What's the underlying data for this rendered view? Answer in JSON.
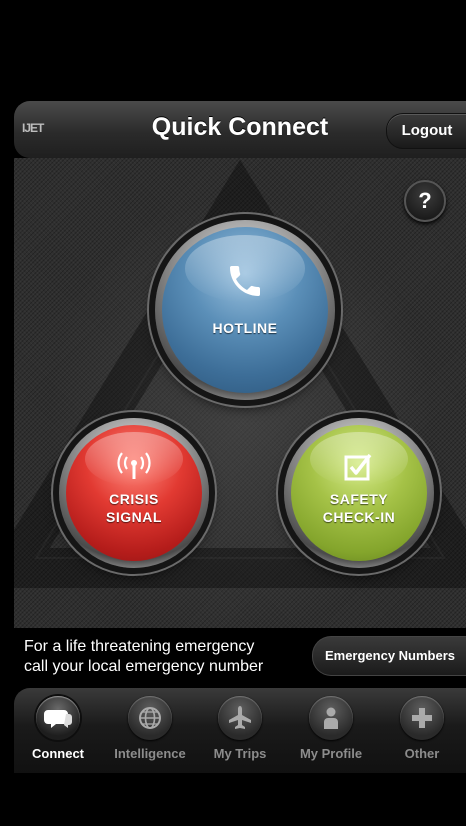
{
  "header": {
    "logo_text": "IJET",
    "title": "Quick Connect",
    "logout_label": "Logout"
  },
  "help": {
    "label": "?"
  },
  "buttons": {
    "hotline": {
      "label": "HOTLINE",
      "icon": "phone-icon",
      "color": "#4a7fab"
    },
    "crisis": {
      "line1": "CRISIS",
      "line2": "SIGNAL",
      "icon": "broadcast-icon",
      "color": "#d42e28"
    },
    "safety": {
      "line1": "SAFETY",
      "line2": "CHECK-IN",
      "icon": "checkbox-icon",
      "color": "#9bb83e"
    }
  },
  "info": {
    "line1": "For a life threatening emergency",
    "line2": "call your local emergency number",
    "button_label": "Emergency Numbers"
  },
  "tabs": [
    {
      "label": "Connect",
      "icon": "chat-bubbles-icon",
      "active": true
    },
    {
      "label": "Intelligence",
      "icon": "globe-icon",
      "active": false
    },
    {
      "label": "My Trips",
      "icon": "airplane-icon",
      "active": false
    },
    {
      "label": "My Profile",
      "icon": "person-icon",
      "active": false
    },
    {
      "label": "Other",
      "icon": "plus-icon",
      "active": false
    }
  ]
}
